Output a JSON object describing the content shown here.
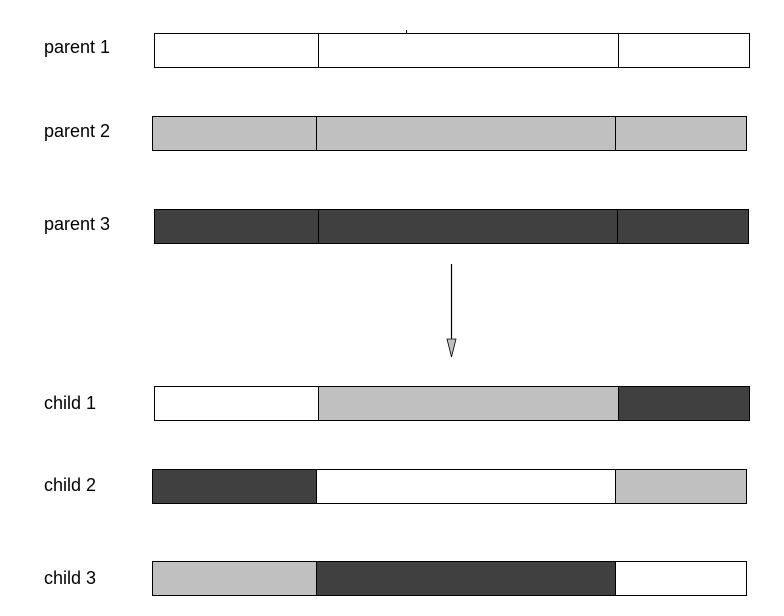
{
  "colors": {
    "white": "#ffffff",
    "light": "#c0c0c0",
    "dark": "#404040",
    "outline": "#000000"
  },
  "segment_proportions": [
    0.276,
    0.504,
    0.22
  ],
  "parents": [
    {
      "label": "parent 1",
      "segments": [
        "white",
        "white",
        "white"
      ]
    },
    {
      "label": "parent 2",
      "segments": [
        "light",
        "light",
        "light"
      ]
    },
    {
      "label": "parent 3",
      "segments": [
        "dark",
        "dark",
        "dark"
      ]
    }
  ],
  "children": [
    {
      "label": "child 1",
      "segments": [
        "white",
        "light",
        "dark"
      ]
    },
    {
      "label": "child 2",
      "segments": [
        "dark",
        "white",
        "light"
      ]
    },
    {
      "label": "child 3",
      "segments": [
        "light",
        "dark",
        "white"
      ]
    }
  ],
  "arrow": {
    "direction": "down",
    "icon": "arrow-down-icon"
  }
}
